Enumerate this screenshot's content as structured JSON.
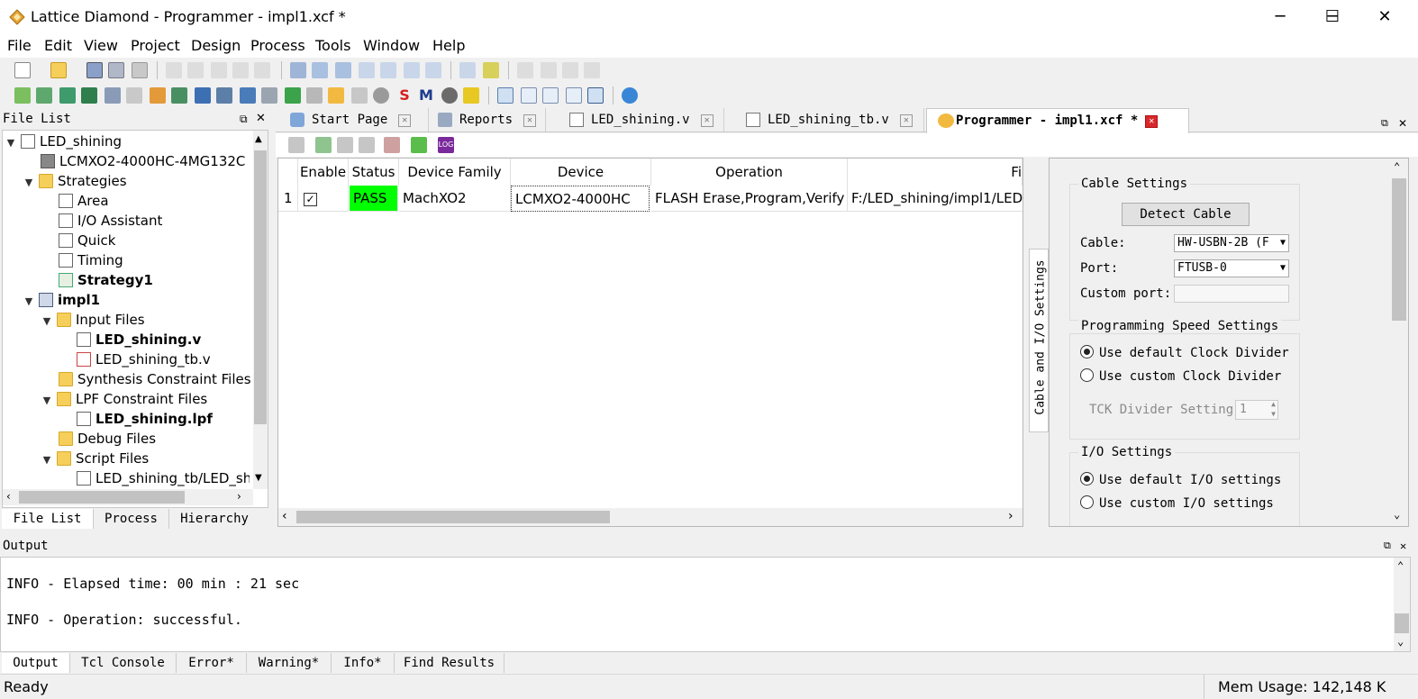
{
  "window": {
    "title": "Lattice Diamond - Programmer - impl1.xcf *",
    "minimize": "─",
    "maximize": "☐",
    "close": "✕"
  },
  "menu": [
    "File",
    "Edit",
    "View",
    "Project",
    "Design",
    "Process",
    "Tools",
    "Window",
    "Help"
  ],
  "file_list": {
    "header": "File List",
    "rows": [
      {
        "label": "LED_shining",
        "bold": false
      },
      {
        "label": "LCMXO2-4000HC-4MG132C",
        "bold": false
      },
      {
        "label": "Strategies",
        "bold": false
      },
      {
        "label": "Area",
        "bold": false
      },
      {
        "label": "I/O Assistant",
        "bold": false
      },
      {
        "label": "Quick",
        "bold": false
      },
      {
        "label": "Timing",
        "bold": false
      },
      {
        "label": "Strategy1",
        "bold": true
      },
      {
        "label": "impl1",
        "bold": true
      },
      {
        "label": "Input Files",
        "bold": false
      },
      {
        "label": "LED_shining.v",
        "bold": true
      },
      {
        "label": "LED_shining_tb.v",
        "bold": false
      },
      {
        "label": "Synthesis Constraint Files",
        "bold": false
      },
      {
        "label": "LPF Constraint Files",
        "bold": false
      },
      {
        "label": "LED_shining.lpf",
        "bold": true
      },
      {
        "label": "Debug Files",
        "bold": false
      },
      {
        "label": "Script Files",
        "bold": false
      },
      {
        "label": "LED_shining_tb/LED_shi",
        "bold": false
      }
    ],
    "tabs": [
      "File List",
      "Process",
      "Hierarchy"
    ]
  },
  "doc_tabs": [
    "Start Page",
    "Reports",
    "LED_shining.v",
    "LED_shining_tb.v",
    "Programmer - impl1.xcf *"
  ],
  "table": {
    "headers": [
      "Enable",
      "Status",
      "Device Family",
      "Device",
      "Operation",
      "Fi"
    ],
    "row": {
      "index": "1",
      "status": "PASS",
      "family": "MachXO2",
      "device": "LCMXO2-4000HC",
      "operation": "FLASH Erase,Program,Verify",
      "file": "F:/LED_shining/impl1/LED_"
    }
  },
  "side_tab": "Cable and I/O Settings",
  "settings": {
    "cable_group": "Cable Settings",
    "detect_button": "Detect Cable",
    "cable_label": "Cable:",
    "cable_value": "HW-USBN-2B (F",
    "port_label": "Port:",
    "port_value": "FTUSB-0",
    "custom_port_label": "Custom port:",
    "speed_group": "Programming Speed Settings",
    "speed_default": "Use default Clock Divider",
    "speed_custom": "Use custom Clock Divider",
    "tck_label": "TCK Divider Setting",
    "tck_value": "1",
    "io_group": "I/O Settings",
    "io_default": "Use default I/O settings",
    "io_custom": "Use custom I/O settings"
  },
  "output": {
    "header": "Output",
    "lines": [
      "INFO - Elapsed time: 00 min : 21 sec",
      "INFO - Operation: successful."
    ],
    "tabs": [
      "Output",
      "Tcl Console",
      "Error*",
      "Warning*",
      "Info*",
      "Find Results"
    ]
  },
  "status": {
    "left": "Ready",
    "mem": "Mem Usage:  142,148 K"
  },
  "colors": {
    "pass": "#00ff00",
    "accent": "#d8282c"
  }
}
